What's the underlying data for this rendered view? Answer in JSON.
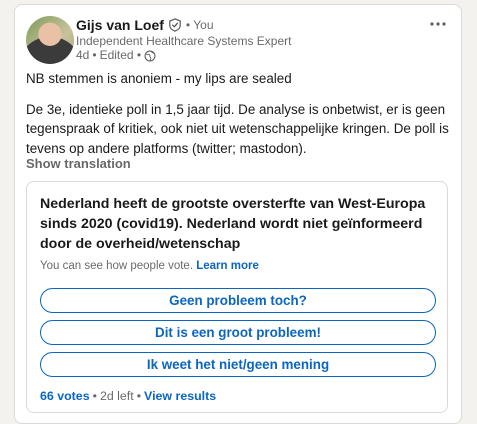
{
  "author": {
    "name": "Gijs van Loef",
    "you_label": "• You",
    "headline": "Independent Healthcare Systems Expert",
    "time": "4d",
    "separator": "•",
    "edited": "Edited •"
  },
  "post": {
    "paragraph1": "NB stemmen is anoniem - my lips are sealed",
    "paragraph2": "De 3e, identieke poll in 1,5 jaar tijd. De analyse is onbetwist, er is geen tegenspraak of kritiek, ook niet uit wetenschappelijke kringen. De poll is tevens op andere platforms (twitter; mastodon).",
    "show_translation": "Show translation"
  },
  "poll": {
    "question": "Nederland heeft de grootste oversterfte van West-Europa sinds 2020 (covid19). Nederland wordt niet geïnformeerd door de overheid/wetenschap",
    "visibility_text": "You can see how people vote.",
    "learn_more": "Learn more",
    "options": [
      {
        "label": "Geen probleem toch?"
      },
      {
        "label": "Dit is een groot probleem!"
      },
      {
        "label": "Ik weet het niet/geen mening"
      }
    ],
    "votes": "66 votes",
    "dot": "•",
    "time_left": "2d left",
    "dot2": "•",
    "view_results": "View results"
  },
  "icons": {
    "more": "more-options-icon",
    "verified": "verified-shield-icon",
    "visibility": "globe-icon"
  },
  "colors": {
    "accent": "#0a66c2",
    "muted": "rgba(0,0,0,0.6)",
    "border": "#dcdad6"
  }
}
